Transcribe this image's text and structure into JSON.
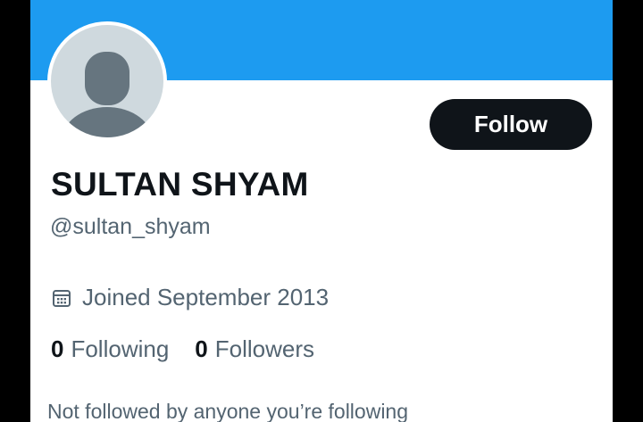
{
  "profile": {
    "display_name": "SULTAN SHYAM",
    "handle": "@sultan_shyam",
    "joined": "Joined September 2013",
    "follow_label": "Follow",
    "not_followed_text": "Not followed by anyone you’re following"
  },
  "stats": {
    "following_count": "0",
    "following_label": "Following",
    "followers_count": "0",
    "followers_label": "Followers"
  },
  "icons": {
    "avatar": "default-avatar-icon",
    "joined": "calendar-icon"
  },
  "colors": {
    "banner": "#1d9bf0",
    "primary_text": "#0f1419",
    "secondary_text": "#536471",
    "avatar_bg": "#cfd9de",
    "avatar_silhouette": "#66757f",
    "button_bg": "#0f1419",
    "button_text": "#ffffff"
  }
}
